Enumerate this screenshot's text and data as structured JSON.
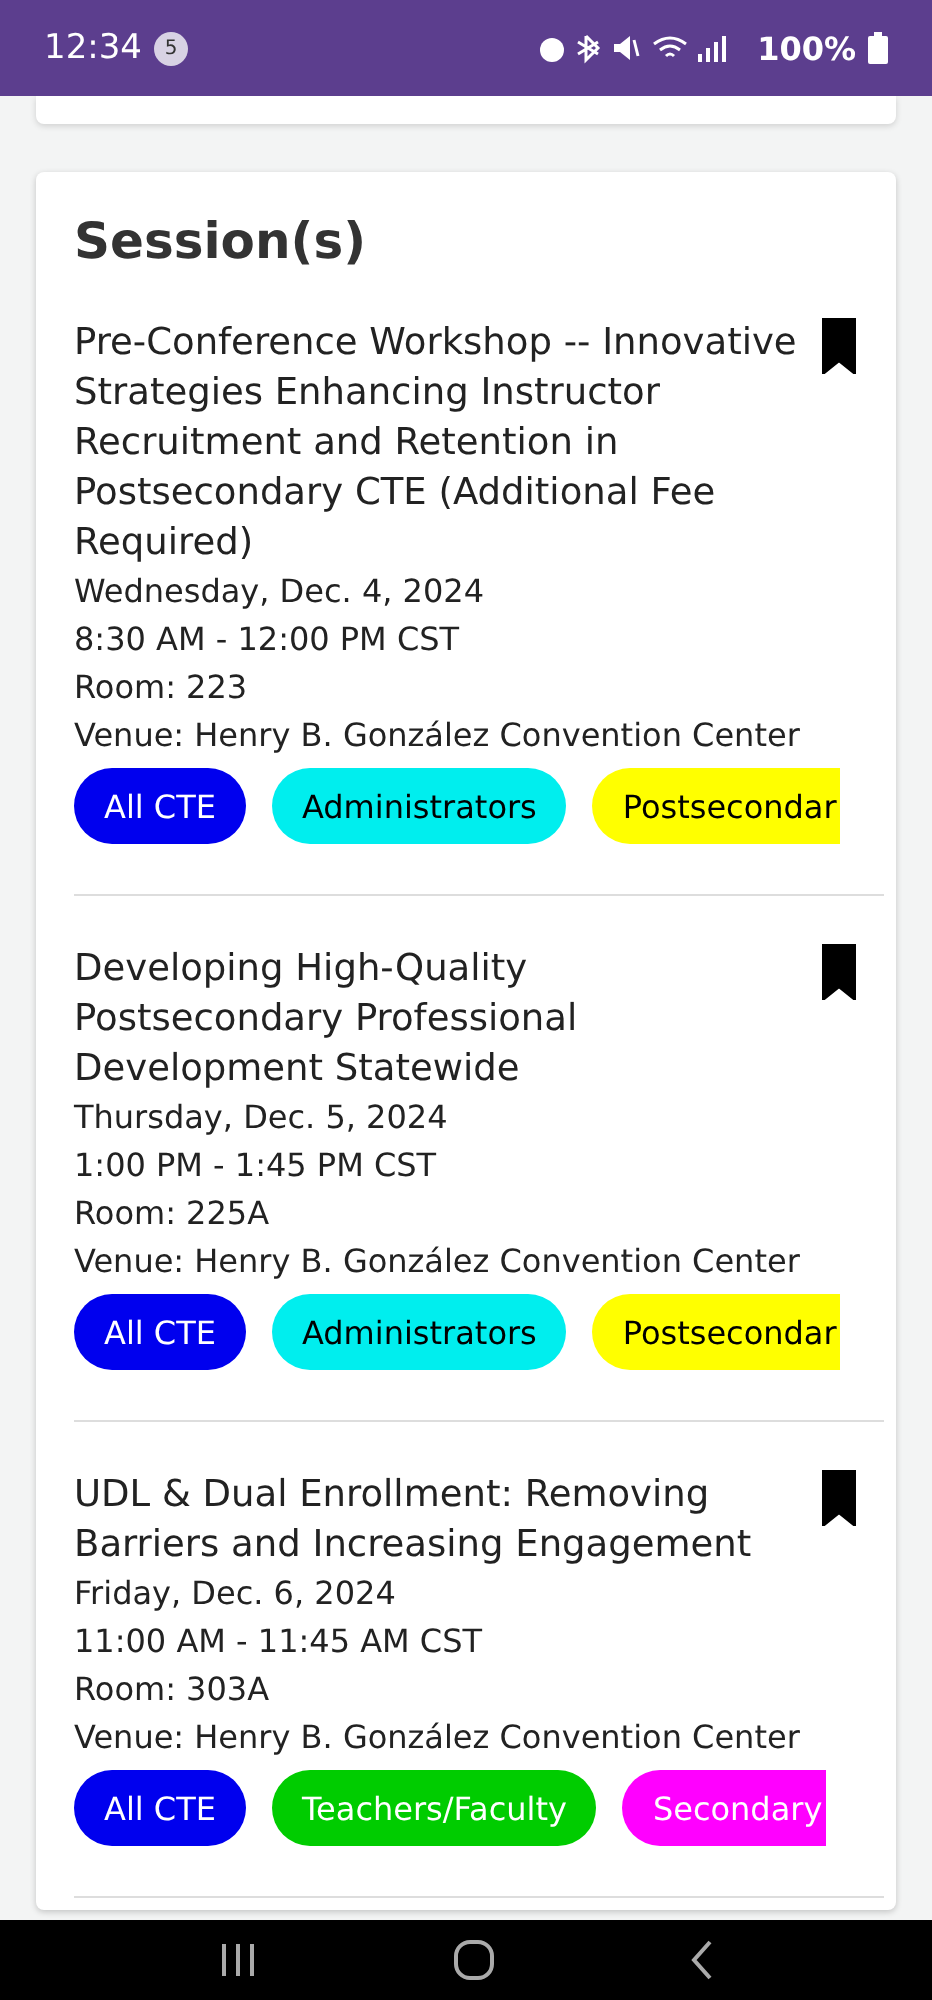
{
  "status_bar": {
    "time": "12:34",
    "notification_count": "5",
    "battery": "100%"
  },
  "section": {
    "title": "Session(s)"
  },
  "sessions": [
    {
      "title": "Pre-Conference Workshop -- Innovative Strategies Enhancing Instructor Recruitment and Retention in Postsecondary CTE (Additional Fee Required)",
      "bookmarked": true,
      "date": "Wednesday, Dec. 4, 2024",
      "time": "8:30 AM - 12:00 PM CST",
      "room": "Room: 223",
      "venue": "Venue: Henry B. González Convention Center",
      "tags": [
        {
          "label": "All CTE",
          "color": "#0000ee"
        },
        {
          "label": "Administrators",
          "color": "#00eeee"
        },
        {
          "label": "Postsecondar",
          "color": "#ffff00"
        }
      ]
    },
    {
      "title": "Developing High-Quality Postsecondary Professional Development Statewide",
      "bookmarked": true,
      "date": "Thursday, Dec. 5, 2024",
      "time": "1:00 PM - 1:45 PM CST",
      "room": "Room: 225A",
      "venue": "Venue: Henry B. González Convention Center",
      "tags": [
        {
          "label": "All CTE",
          "color": "#0000ee"
        },
        {
          "label": "Administrators",
          "color": "#00eeee"
        },
        {
          "label": "Postsecondar",
          "color": "#ffff00"
        }
      ]
    },
    {
      "title": "UDL & Dual Enrollment: Removing Barriers and Increasing Engagement",
      "bookmarked": true,
      "date": "Friday, Dec. 6, 2024",
      "time": "11:00 AM - 11:45 AM CST",
      "room": "Room: 303A",
      "venue": "Venue: Henry B. González Convention Center",
      "tags": [
        {
          "label": "All CTE",
          "color": "#0000ee"
        },
        {
          "label": "Teachers/Faculty",
          "color": "#00cc00"
        },
        {
          "label": "Secondary",
          "color": "#ff00ff"
        }
      ]
    }
  ]
}
